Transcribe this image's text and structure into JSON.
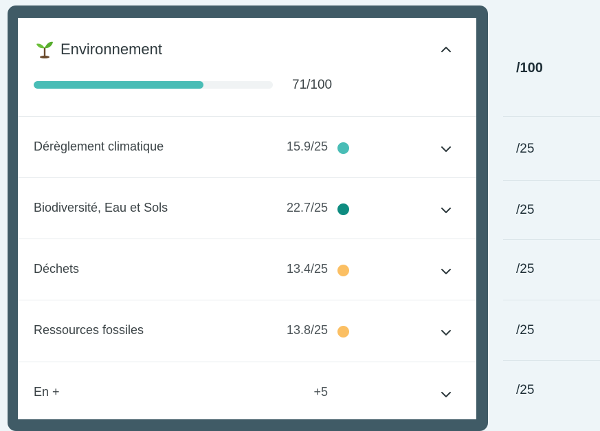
{
  "section": {
    "title": "Environnement",
    "icon": "sprout-icon",
    "score_label": "71/100",
    "score_fraction": 0.71,
    "accent": "#49bdb6"
  },
  "rows": [
    {
      "label": "Dérèglement climatique",
      "score": "15.9/25",
      "dot_color": "#49bdb6"
    },
    {
      "label": "Biodiversité, Eau et Sols",
      "score": "22.7/25",
      "dot_color": "#0e8c80"
    },
    {
      "label": "Déchets",
      "score": "13.4/25",
      "dot_color": "#fbbf63"
    },
    {
      "label": "Ressources fossiles",
      "score": "13.8/25",
      "dot_color": "#fbbf63"
    },
    {
      "label": "En +",
      "score": "+5",
      "dot_color": ""
    }
  ],
  "side_column": {
    "header": "/100",
    "items": [
      "/25",
      "/25",
      "/25",
      "/25",
      "/25"
    ]
  }
}
